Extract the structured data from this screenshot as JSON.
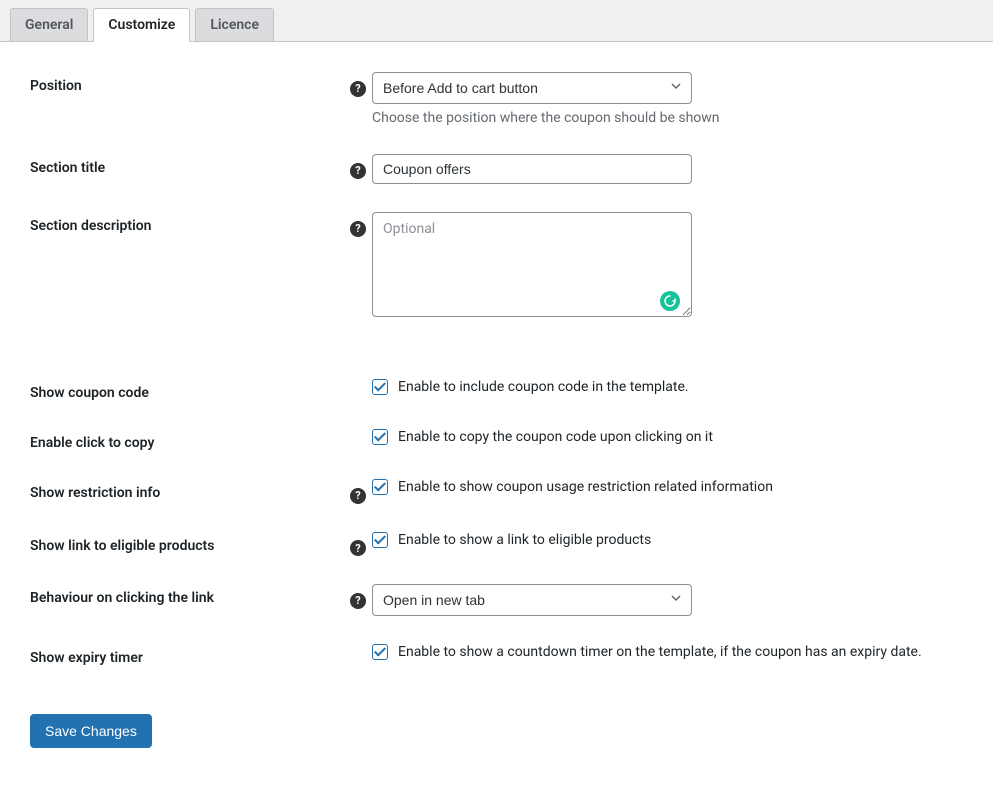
{
  "tabs": {
    "general": "General",
    "customize": "Customize",
    "licence": "Licence"
  },
  "position": {
    "label": "Position",
    "value": "Before Add to cart button",
    "help": "Choose the position where the coupon should be shown"
  },
  "section_title": {
    "label": "Section title",
    "value": "Coupon offers"
  },
  "section_description": {
    "label": "Section description",
    "placeholder": "Optional",
    "value": ""
  },
  "show_coupon_code": {
    "label": "Show coupon code",
    "desc": "Enable to include coupon code in the template."
  },
  "enable_click_copy": {
    "label": "Enable click to copy",
    "desc": "Enable to copy the coupon code upon clicking on it"
  },
  "show_restriction": {
    "label": "Show restriction info",
    "desc": "Enable to show coupon usage restriction related information"
  },
  "show_link_eligible": {
    "label": "Show link to eligible products",
    "desc": "Enable to show a link to eligible products"
  },
  "behaviour_link": {
    "label": "Behaviour on clicking the link",
    "value": "Open in new tab"
  },
  "show_expiry": {
    "label": "Show expiry timer",
    "desc": "Enable to show a countdown timer on the template, if the coupon has an expiry date."
  },
  "save_button": "Save Changes"
}
